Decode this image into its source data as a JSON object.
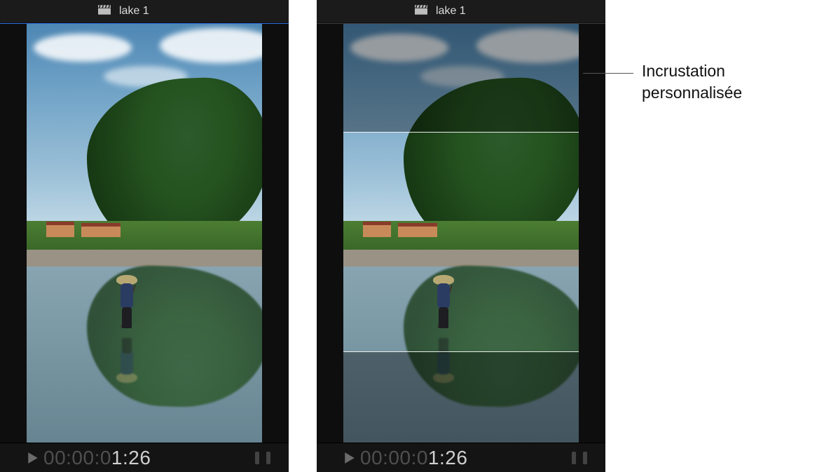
{
  "viewers": {
    "left": {
      "clip_title": "lake 1",
      "timecode_dim": "00:00:0",
      "timecode_bright": "1:26"
    },
    "right": {
      "clip_title": "lake 1",
      "timecode_dim": "00:00:0",
      "timecode_bright": "1:26"
    }
  },
  "annotation": {
    "label": "Incrustation personnalisée"
  },
  "icons": {
    "clapper": "clapper-icon",
    "play": "play-icon",
    "audio": "audio-meter-icon"
  }
}
